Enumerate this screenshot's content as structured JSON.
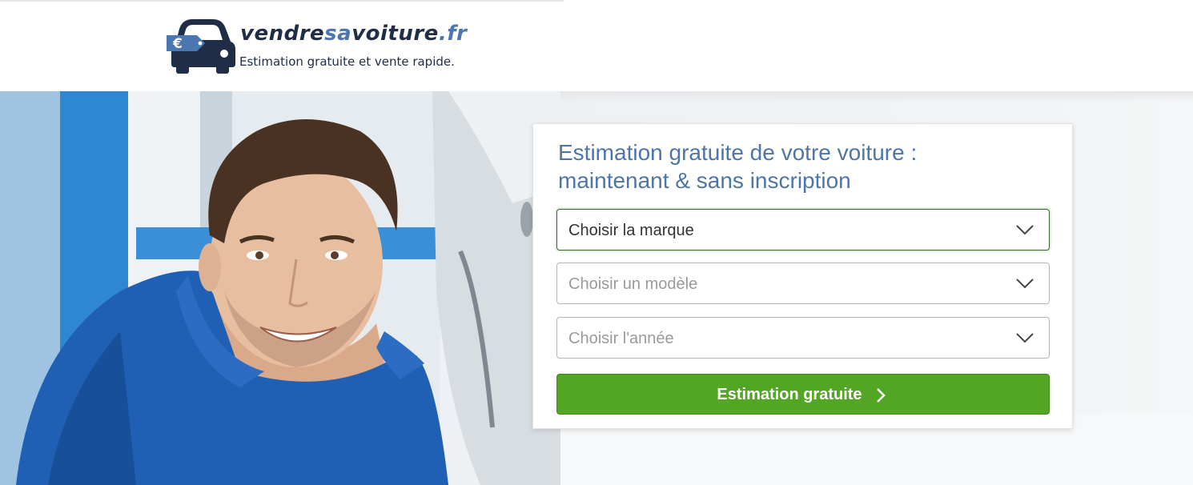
{
  "header": {
    "logo_text_part1": "vendre",
    "logo_text_part2": "sa",
    "logo_text_part3": "voiture",
    "logo_text_part4": ".fr",
    "tagline": "Estimation gratuite et vente rapide."
  },
  "form": {
    "title_line1": "Estimation gratuite de votre voiture :",
    "title_line2": "maintenant & sans inscription",
    "brand_select": "Choisir la marque",
    "model_select": "Choisir un modèle",
    "year_select": "Choisir l'année",
    "submit_label": "Estimation gratuite"
  },
  "colors": {
    "accent_blue": "#4d76a7",
    "logo_navy": "#1f2d47",
    "button_green": "#53a524"
  },
  "icons": {
    "logo": "car-with-euro-tag-icon",
    "select_arrow": "chevron-down-icon",
    "button_arrow": "chevron-right-icon"
  }
}
